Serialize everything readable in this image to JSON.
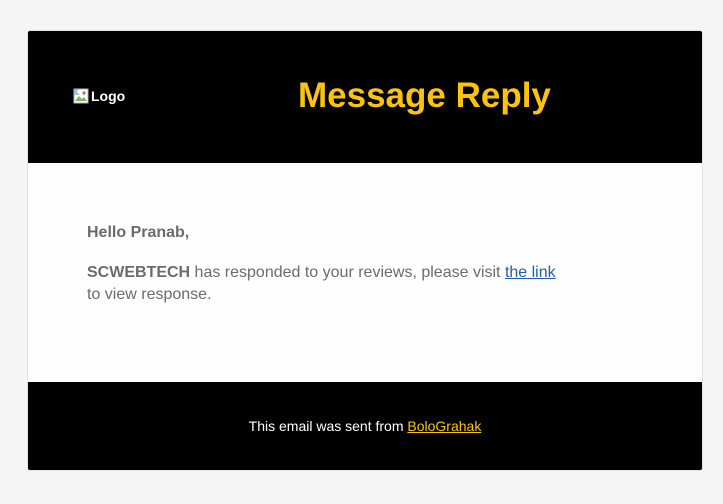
{
  "header": {
    "logo_alt": "Logo",
    "title": "Message Reply"
  },
  "body": {
    "greeting": "Hello Pranab,",
    "company": "SCWEBTECH",
    "message_text": " has responded to your reviews, please visit ",
    "link_label": "the link",
    "message_tail": " to view response."
  },
  "footer": {
    "sent_from_text": "This email was sent from ",
    "brand_link": "BoloGrahak"
  },
  "colors": {
    "header_bg": "#000000",
    "title_color": "#fcc30d",
    "link_color": "#1f5fae",
    "text_color": "#6b6b6b",
    "footer_link": "#fcc30d",
    "page_bg": "#f5f5f5"
  },
  "icons": {
    "logo_placeholder": "broken-image-icon"
  }
}
